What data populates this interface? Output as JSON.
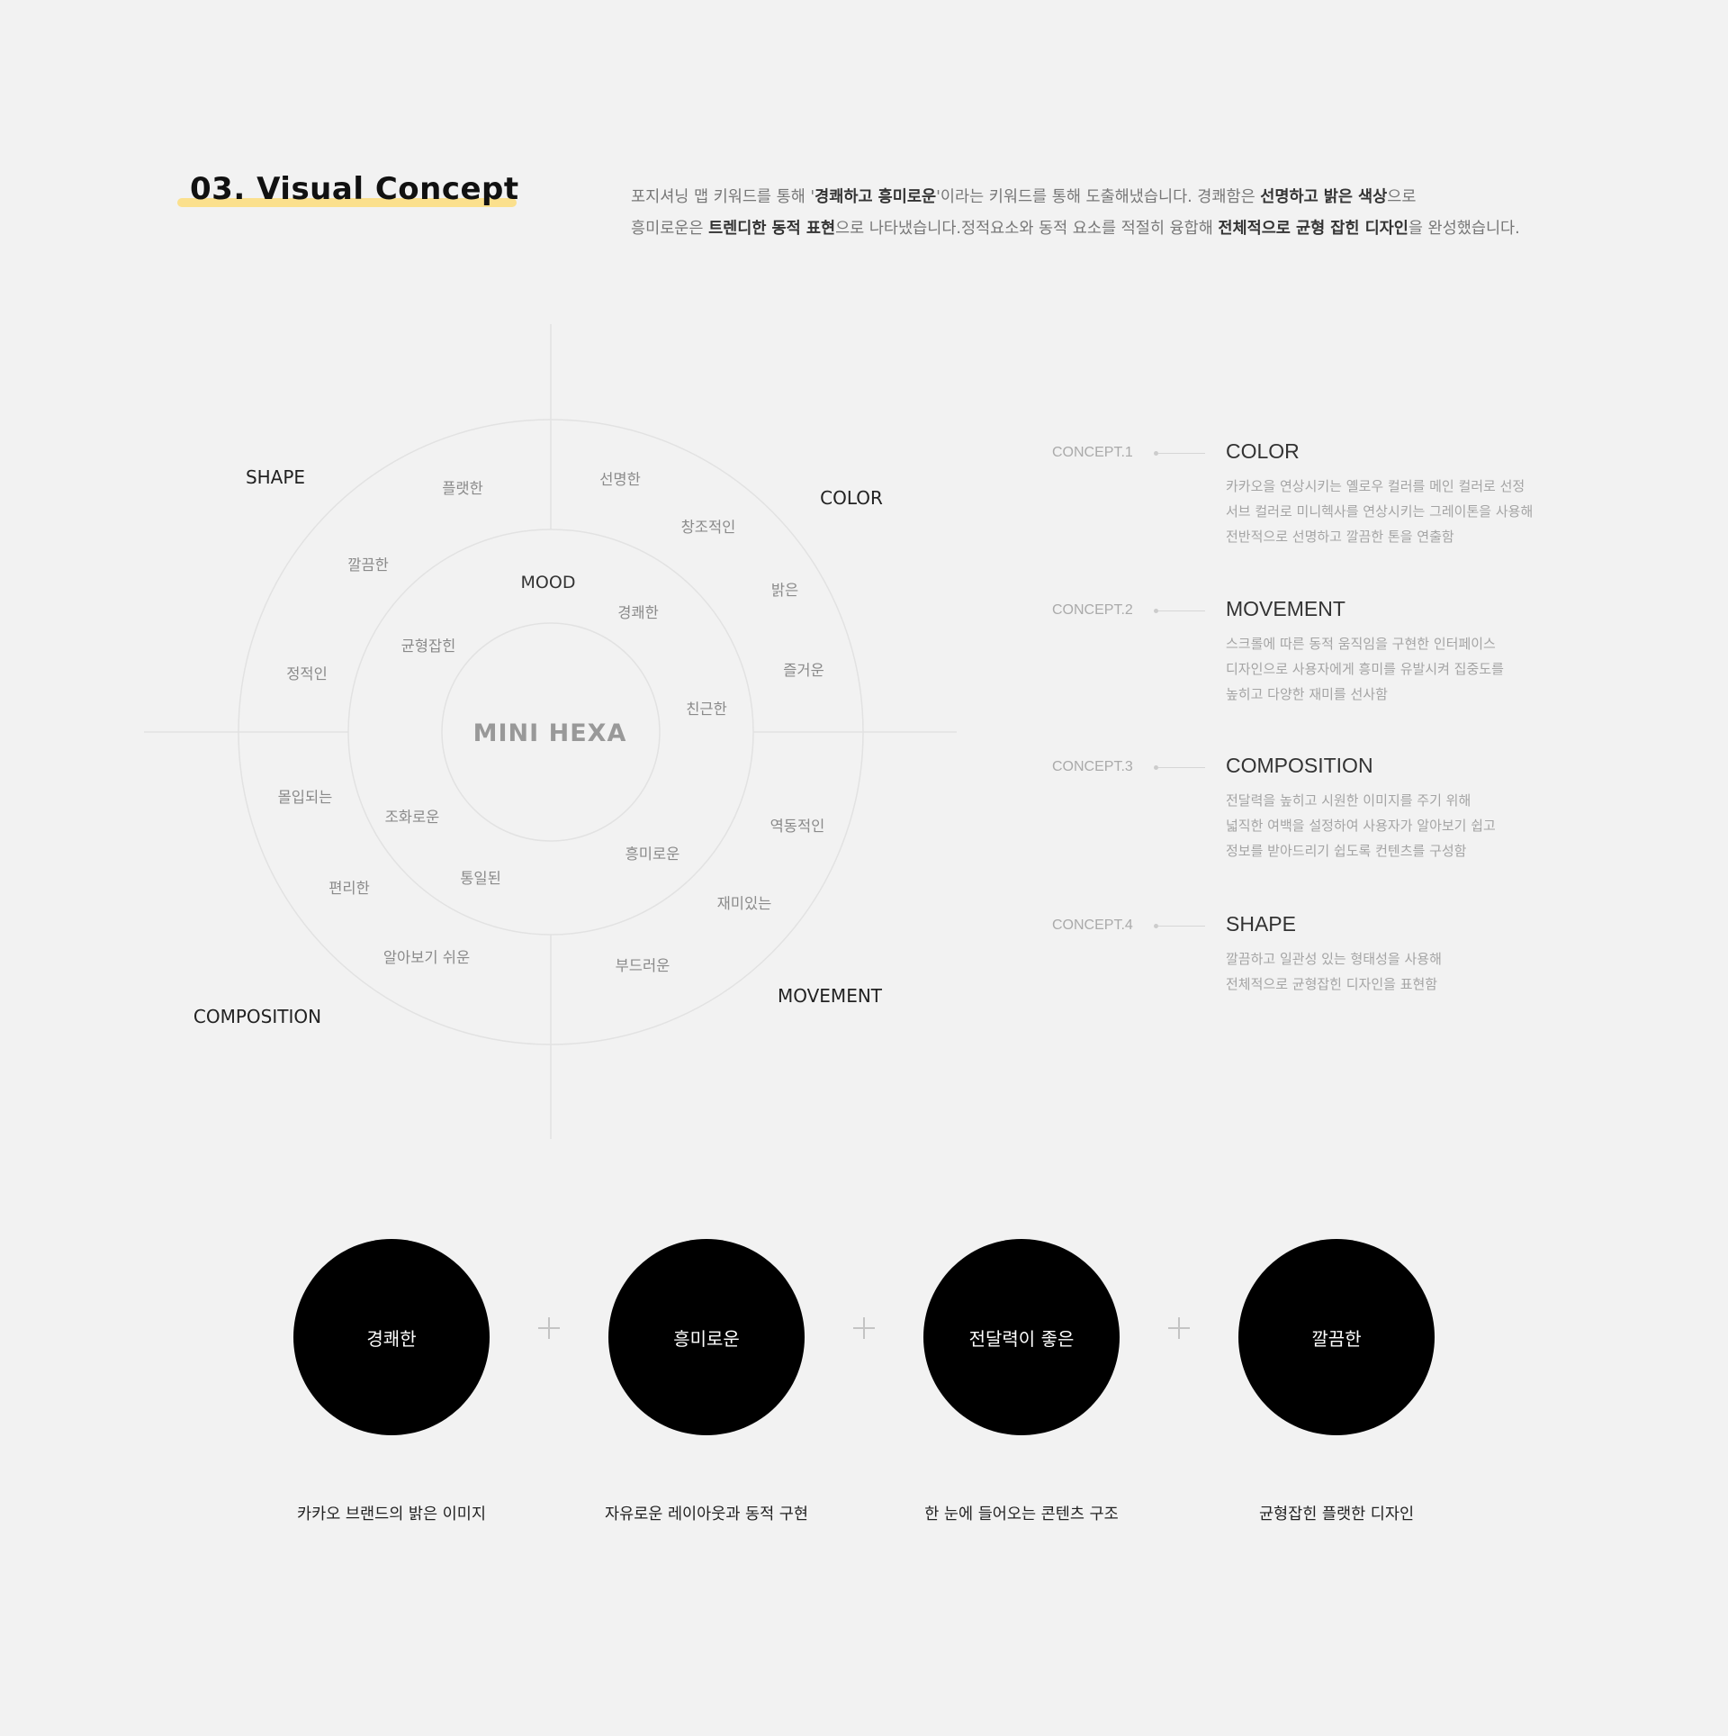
{
  "header": {
    "title": "03. Visual Concept",
    "desc_line1": [
      {
        "text": "포지셔닝 맵 키워드를 통해 '",
        "bold": false
      },
      {
        "text": "경쾌하고 흥미로운",
        "bold": true
      },
      {
        "text": "'이라는 키워드를 통해 도출해냈습니다. 경쾌함은 ",
        "bold": false
      },
      {
        "text": "선명하고 밝은 색상",
        "bold": true
      },
      {
        "text": "으로",
        "bold": false
      }
    ],
    "desc_line2": [
      {
        "text": "흥미로운은 ",
        "bold": false
      },
      {
        "text": "트렌디한 동적 표현",
        "bold": true
      },
      {
        "text": "으로 나타냈습니다.정적요소와 동적 요소를 적절히 융합해 ",
        "bold": false
      },
      {
        "text": "전체적으로 균형 잡힌 디자인",
        "bold": true
      },
      {
        "text": "을 완성했습니다.",
        "bold": false
      }
    ]
  },
  "diagram": {
    "center_label": "MINI HEXA",
    "mood_label": "MOOD",
    "quadrants": {
      "shape": "SHAPE",
      "color": "COLOR",
      "composition": "COMPOSITION",
      "movement": "MOVEMENT"
    },
    "keywords": [
      {
        "id": "flat",
        "text": "플랫한"
      },
      {
        "id": "vivid",
        "text": "선명한"
      },
      {
        "id": "creative",
        "text": "창조적인"
      },
      {
        "id": "clean",
        "text": "깔끔한"
      },
      {
        "id": "bright",
        "text": "밝은"
      },
      {
        "id": "cheerful",
        "text": "경쾌한"
      },
      {
        "id": "balanced",
        "text": "균형잡힌"
      },
      {
        "id": "static",
        "text": "정적인"
      },
      {
        "id": "joyful",
        "text": "즐거운"
      },
      {
        "id": "friendly",
        "text": "친근한"
      },
      {
        "id": "immersive",
        "text": "몰입되는"
      },
      {
        "id": "harmonious",
        "text": "조화로운"
      },
      {
        "id": "dynamic",
        "text": "역동적인"
      },
      {
        "id": "interesting",
        "text": "흥미로운"
      },
      {
        "id": "convenient",
        "text": "편리한"
      },
      {
        "id": "unified",
        "text": "통일된"
      },
      {
        "id": "fun",
        "text": "재미있는"
      },
      {
        "id": "easy",
        "text": "알아보기 쉬운"
      },
      {
        "id": "soft",
        "text": "부드러운"
      }
    ]
  },
  "concepts": [
    {
      "code": "CONCEPT.1",
      "title": "COLOR",
      "lines": [
        "카카오을 연상시키는 옐로우 컬러를 메인 컬러로 선정",
        "서브 컬러로 미니헥사를 연상시키는 그레이톤을 사용해",
        "전반적으로 선명하고 깔끔한 톤을 연출함"
      ]
    },
    {
      "code": "CONCEPT.2",
      "title": "MOVEMENT",
      "lines": [
        "스크롤에 따른 동적 움직임을 구현한 인터페이스",
        "디자인으로 사용자에게 흥미를 유발시켜 집중도를",
        "높히고  다양한 재미를 선사함"
      ]
    },
    {
      "code": "CONCEPT.3",
      "title": "COMPOSITION",
      "lines": [
        "전달력을 높히고 시원한 이미지를 주기 위해",
        "넓직한 여백을 설정하여 사용자가 알아보기 쉽고",
        "정보를 받아드리기 쉽도록 컨텐츠를 구성함"
      ]
    },
    {
      "code": "CONCEPT.4",
      "title": "SHAPE",
      "lines": [
        "깔끔하고 일관성 있는 형태성을 사용해",
        "전체적으로 균형잡힌 디자인을 표현함"
      ]
    }
  ],
  "keywords_row": [
    {
      "label": "경쾌한",
      "caption": "카카오 브랜드의 밝은 이미지"
    },
    {
      "label": "흥미로운",
      "caption": "자유로운 레이아웃과 동적 구현"
    },
    {
      "label": "전달력이 좋은",
      "caption": "한 눈에 들어오는 콘텐츠 구조"
    },
    {
      "label": "깔끔한",
      "caption": "균형잡힌 플랫한 디자인"
    }
  ]
}
